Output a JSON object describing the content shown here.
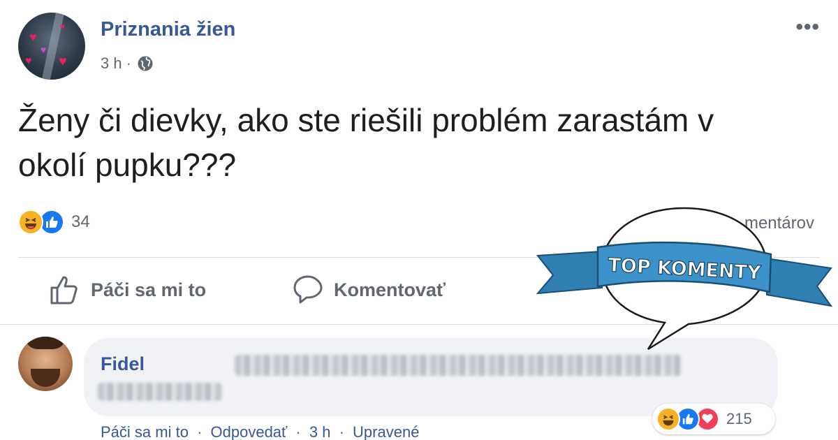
{
  "post": {
    "page_name": "Priznania žien",
    "time": "3 h",
    "separator": "·",
    "text": "Ženy či dievky, ako ste riešili problém zarastám v okolí pupku???",
    "reaction_count": "34",
    "comments_count": "mentárov",
    "actions": {
      "like": "Páči sa mi to",
      "comment": "Komentovať"
    }
  },
  "comment": {
    "author": "Fidel",
    "reaction_count": "215",
    "meta": {
      "like": "Páči sa mi to",
      "reply": "Odpovedať",
      "time": "3 h",
      "edited": "Upravené",
      "separator": "·"
    }
  },
  "badge": {
    "label": "TOP KOMENTY",
    "ribbon_color": "#3d93c9",
    "bubble_fill": "#ffffff"
  },
  "colors": {
    "link": "#385898",
    "secondary_text": "#606770",
    "like_blue": "#1877f2",
    "haha_yellow": "#f7b125",
    "love_red": "#f33e58"
  }
}
